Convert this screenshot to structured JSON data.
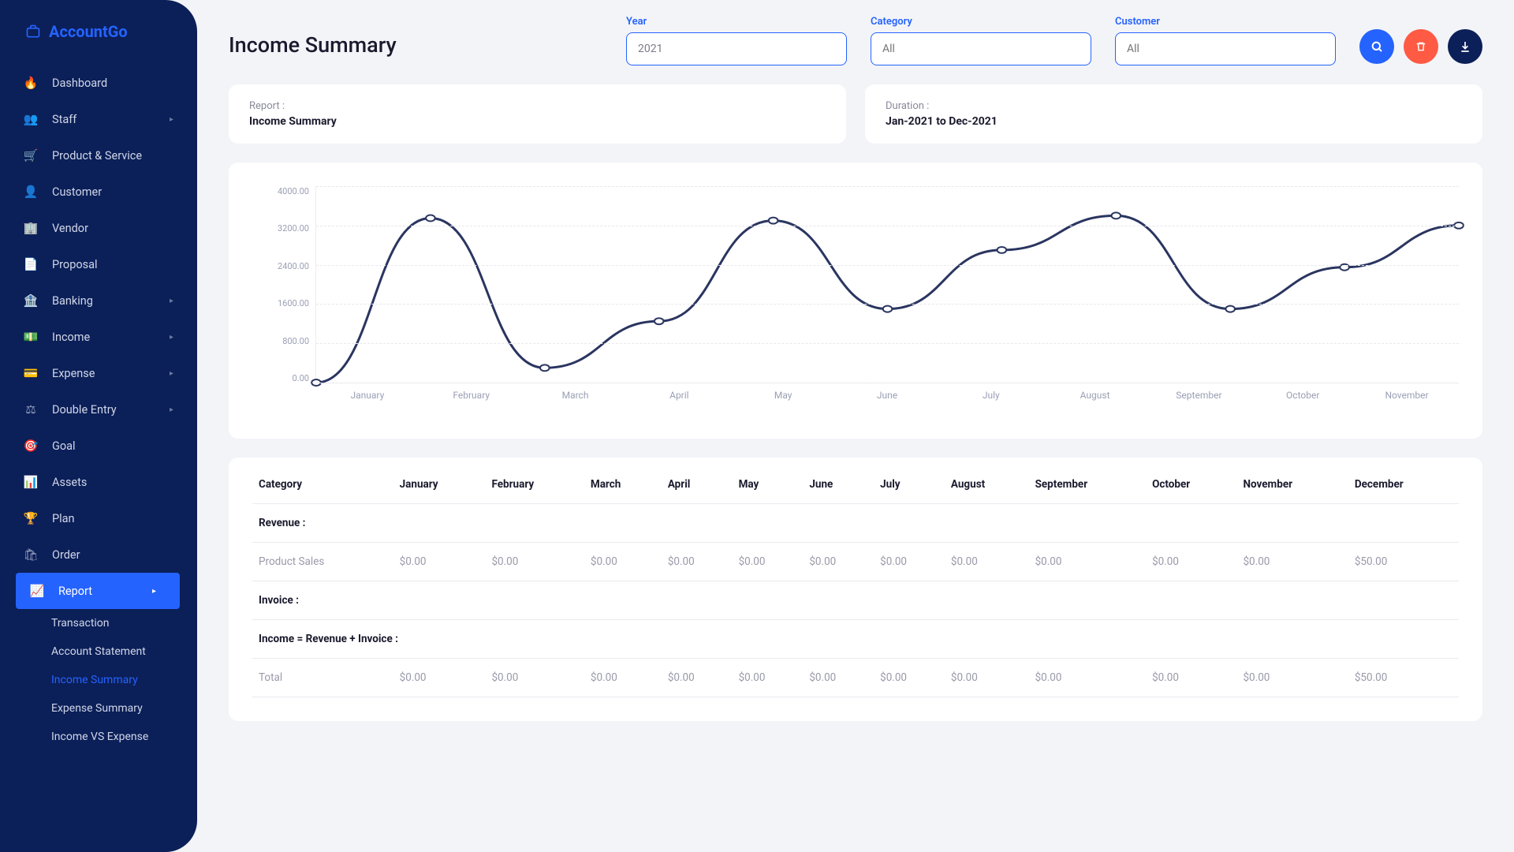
{
  "brand": "AccountGo",
  "sidebar": {
    "items": [
      {
        "label": "Dashboard"
      },
      {
        "label": "Staff",
        "chev": true
      },
      {
        "label": "Product & Service"
      },
      {
        "label": "Customer"
      },
      {
        "label": "Vendor"
      },
      {
        "label": "Proposal"
      },
      {
        "label": "Banking",
        "chev": true
      },
      {
        "label": "Income",
        "chev": true
      },
      {
        "label": "Expense",
        "chev": true
      },
      {
        "label": "Double Entry",
        "chev": true
      },
      {
        "label": "Goal"
      },
      {
        "label": "Assets"
      },
      {
        "label": "Plan"
      },
      {
        "label": "Order"
      },
      {
        "label": "Report",
        "chev": true,
        "active": true
      }
    ],
    "sub": [
      {
        "label": "Transaction"
      },
      {
        "label": "Account Statement"
      },
      {
        "label": "Income Summary",
        "active": true
      },
      {
        "label": "Expense Summary"
      },
      {
        "label": "Income VS Expense"
      }
    ]
  },
  "page_title": "Income Summary",
  "filters": {
    "year": {
      "label": "Year",
      "value": "2021"
    },
    "category": {
      "label": "Category",
      "placeholder": "All"
    },
    "customer": {
      "label": "Customer",
      "placeholder": "All"
    }
  },
  "info": {
    "report_label": "Report :",
    "report_value": "Income Summary",
    "duration_label": "Duration :",
    "duration_value": "Jan-2021 to Dec-2021"
  },
  "chart_data": {
    "type": "line",
    "categories": [
      "January",
      "February",
      "March",
      "April",
      "May",
      "June",
      "July",
      "August",
      "September",
      "October",
      "November"
    ],
    "values": [
      0,
      3350,
      300,
      1250,
      3300,
      1500,
      2700,
      3400,
      1500,
      2350,
      3200
    ],
    "ylim": [
      0,
      4000
    ],
    "yticks": [
      "4000.00",
      "3200.00",
      "2400.00",
      "1600.00",
      "800.00",
      "0.00"
    ]
  },
  "table": {
    "headers": [
      "Category",
      "January",
      "February",
      "March",
      "April",
      "May",
      "June",
      "July",
      "August",
      "September",
      "October",
      "November",
      "December"
    ],
    "revenue_label": "Revenue :",
    "product_sales_label": "Product Sales",
    "product_sales": [
      "$0.00",
      "$0.00",
      "$0.00",
      "$0.00",
      "$0.00",
      "$0.00",
      "$0.00",
      "$0.00",
      "$0.00",
      "$0.00",
      "$0.00",
      "$50.00"
    ],
    "invoice_label": "Invoice :",
    "formula_label": "Income = Revenue + Invoice :",
    "total_label": "Total",
    "total": [
      "$0.00",
      "$0.00",
      "$0.00",
      "$0.00",
      "$0.00",
      "$0.00",
      "$0.00",
      "$0.00",
      "$0.00",
      "$0.00",
      "$0.00",
      "$50.00"
    ]
  }
}
